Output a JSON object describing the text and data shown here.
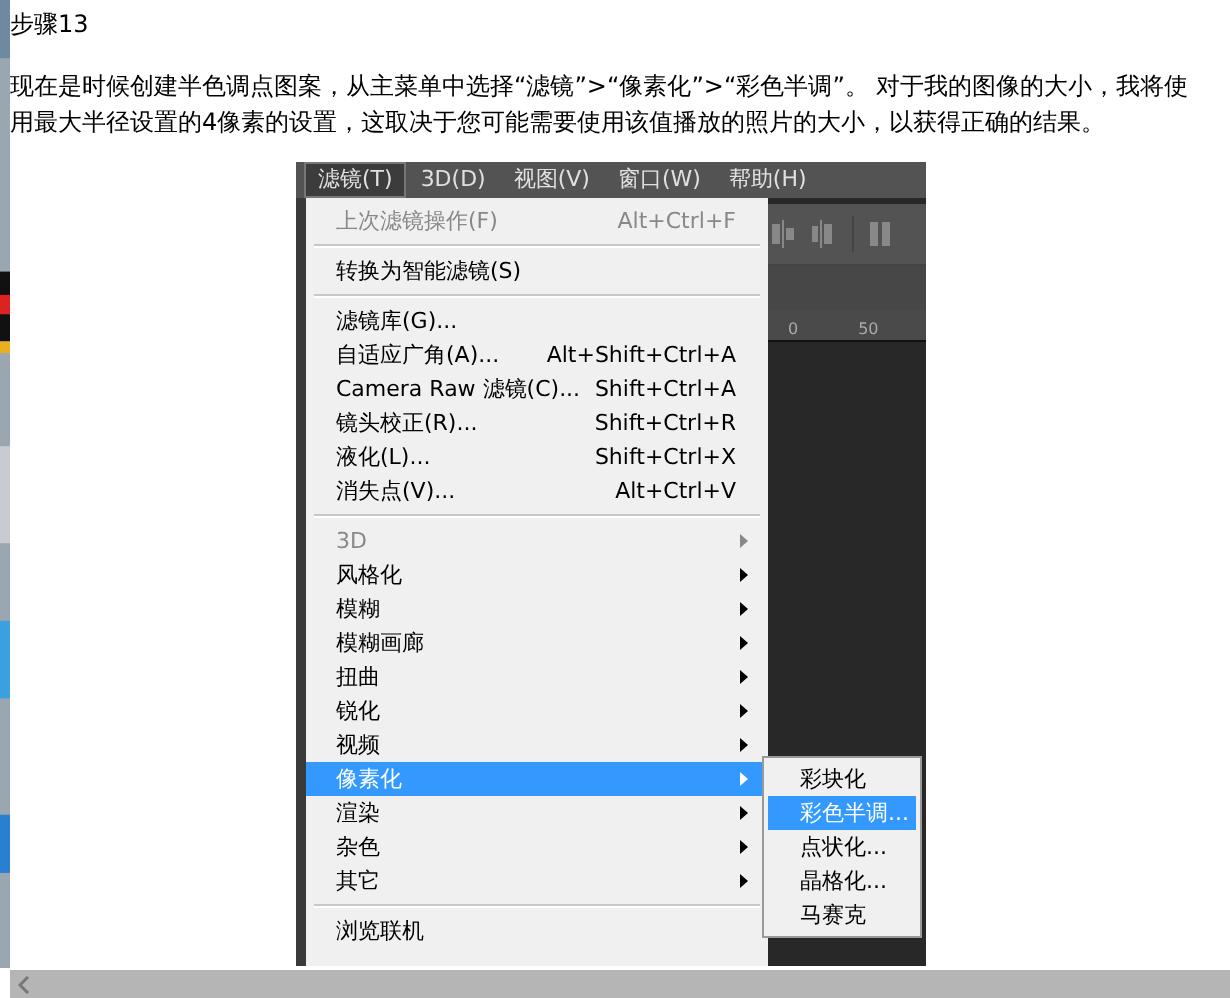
{
  "article": {
    "heading": "步骤13",
    "paragraph": "现在是时候创建半色调点图案，从主菜单中选择“滤镜”>“像素化”>“彩色半调”。 对于我的图像的大小，我将使用最大半径设置的4像素的设置，这取决于您可能需要使用该值播放的照片的大小，以获得正确的结果。"
  },
  "screenshot": {
    "menubar": [
      {
        "label": "滤镜(T)",
        "selected": true
      },
      {
        "label": "3D(D)",
        "selected": false
      },
      {
        "label": "视图(V)",
        "selected": false
      },
      {
        "label": "窗口(W)",
        "selected": false
      },
      {
        "label": "帮助(H)",
        "selected": false
      }
    ],
    "menu": [
      {
        "kind": "item",
        "label": "上次滤镜操作(F)",
        "shortcut": "Alt+Ctrl+F",
        "disabled": true,
        "submenu": false,
        "selected": false
      },
      {
        "kind": "separator"
      },
      {
        "kind": "item",
        "label": "转换为智能滤镜(S)",
        "disabled": false,
        "submenu": false,
        "selected": false
      },
      {
        "kind": "separator"
      },
      {
        "kind": "item",
        "label": "滤镜库(G)...",
        "disabled": false,
        "submenu": false,
        "selected": false
      },
      {
        "kind": "item",
        "label": "自适应广角(A)...",
        "shortcut": "Alt+Shift+Ctrl+A",
        "disabled": false,
        "submenu": false,
        "selected": false
      },
      {
        "kind": "item",
        "label": "Camera Raw 滤镜(C)...",
        "shortcut": "Shift+Ctrl+A",
        "disabled": false,
        "submenu": false,
        "selected": false
      },
      {
        "kind": "item",
        "label": "镜头校正(R)...",
        "shortcut": "Shift+Ctrl+R",
        "disabled": false,
        "submenu": false,
        "selected": false
      },
      {
        "kind": "item",
        "label": "液化(L)...",
        "shortcut": "Shift+Ctrl+X",
        "disabled": false,
        "submenu": false,
        "selected": false
      },
      {
        "kind": "item",
        "label": "消失点(V)...",
        "shortcut": "Alt+Ctrl+V",
        "disabled": false,
        "submenu": false,
        "selected": false
      },
      {
        "kind": "separator"
      },
      {
        "kind": "item",
        "label": "3D",
        "disabled": true,
        "submenu": true,
        "selected": false
      },
      {
        "kind": "item",
        "label": "风格化",
        "disabled": false,
        "submenu": true,
        "selected": false
      },
      {
        "kind": "item",
        "label": "模糊",
        "disabled": false,
        "submenu": true,
        "selected": false
      },
      {
        "kind": "item",
        "label": "模糊画廊",
        "disabled": false,
        "submenu": true,
        "selected": false
      },
      {
        "kind": "item",
        "label": "扭曲",
        "disabled": false,
        "submenu": true,
        "selected": false
      },
      {
        "kind": "item",
        "label": "锐化",
        "disabled": false,
        "submenu": true,
        "selected": false
      },
      {
        "kind": "item",
        "label": "视频",
        "disabled": false,
        "submenu": true,
        "selected": false
      },
      {
        "kind": "item",
        "label": "像素化",
        "disabled": false,
        "submenu": true,
        "selected": true
      },
      {
        "kind": "item",
        "label": "渲染",
        "disabled": false,
        "submenu": true,
        "selected": false
      },
      {
        "kind": "item",
        "label": "杂色",
        "disabled": false,
        "submenu": true,
        "selected": false
      },
      {
        "kind": "item",
        "label": "其它",
        "disabled": false,
        "submenu": true,
        "selected": false
      },
      {
        "kind": "separator"
      },
      {
        "kind": "item",
        "label": "浏览联机",
        "disabled": false,
        "submenu": false,
        "selected": false
      }
    ],
    "submenu": [
      {
        "label": "彩块化",
        "selected": false
      },
      {
        "label": "彩色半调...",
        "selected": true
      },
      {
        "label": "点状化...",
        "selected": false
      },
      {
        "label": "晶格化...",
        "selected": false
      },
      {
        "label": "马赛克",
        "selected": false
      }
    ],
    "ruler": [
      "0",
      "50"
    ]
  }
}
